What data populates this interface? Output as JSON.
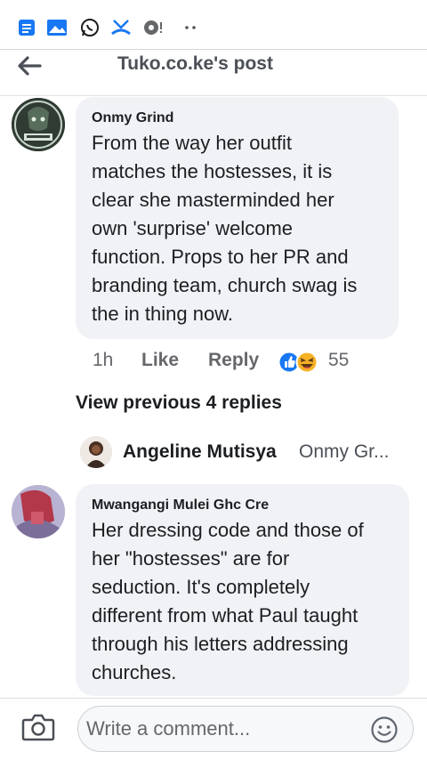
{
  "status_bar": {
    "icons": [
      "notes-icon",
      "gallery-icon",
      "whatsapp-icon",
      "missed-call-icon",
      "data-saver-icon",
      "more-dots-icon"
    ]
  },
  "header": {
    "title": "Tuko.co.ke's post",
    "back_icon": "arrow-left-icon"
  },
  "comments": [
    {
      "author": "Onmy Grind",
      "text": "From the way her outfit\nmatches the hostesses, it is\nclear she masterminded her\nown 'surprise' welcome\nfunction. Props to her PR and\nbranding team, church swag is\nthe in thing now.",
      "time": "1h",
      "like_label": "Like",
      "reply_label": "Reply",
      "reaction_icons": [
        "like-reaction-icon",
        "haha-reaction-icon"
      ],
      "reaction_count": "55"
    },
    {
      "author": "Mwangangi Mulei Ghc Cre",
      "text": "Her dressing code and those of\nher \"hostesses\" are for\nseduction. It's completely\ndifferent from what Paul taught\nthrough his letters addressing\nchurches."
    }
  ],
  "view_previous_label": "View previous 4 replies",
  "reply_preview": {
    "name": "Angeline Mutisya",
    "text": "Onmy Gr..."
  },
  "composer": {
    "placeholder": "Write a comment...",
    "camera_icon": "camera-icon",
    "emoji_icon": "emoji-icon"
  },
  "colors": {
    "bubble": "#f0f2f5",
    "muted_text": "#65676b",
    "like_blue": "#1877f2",
    "haha_yellow": "#f7b125"
  }
}
